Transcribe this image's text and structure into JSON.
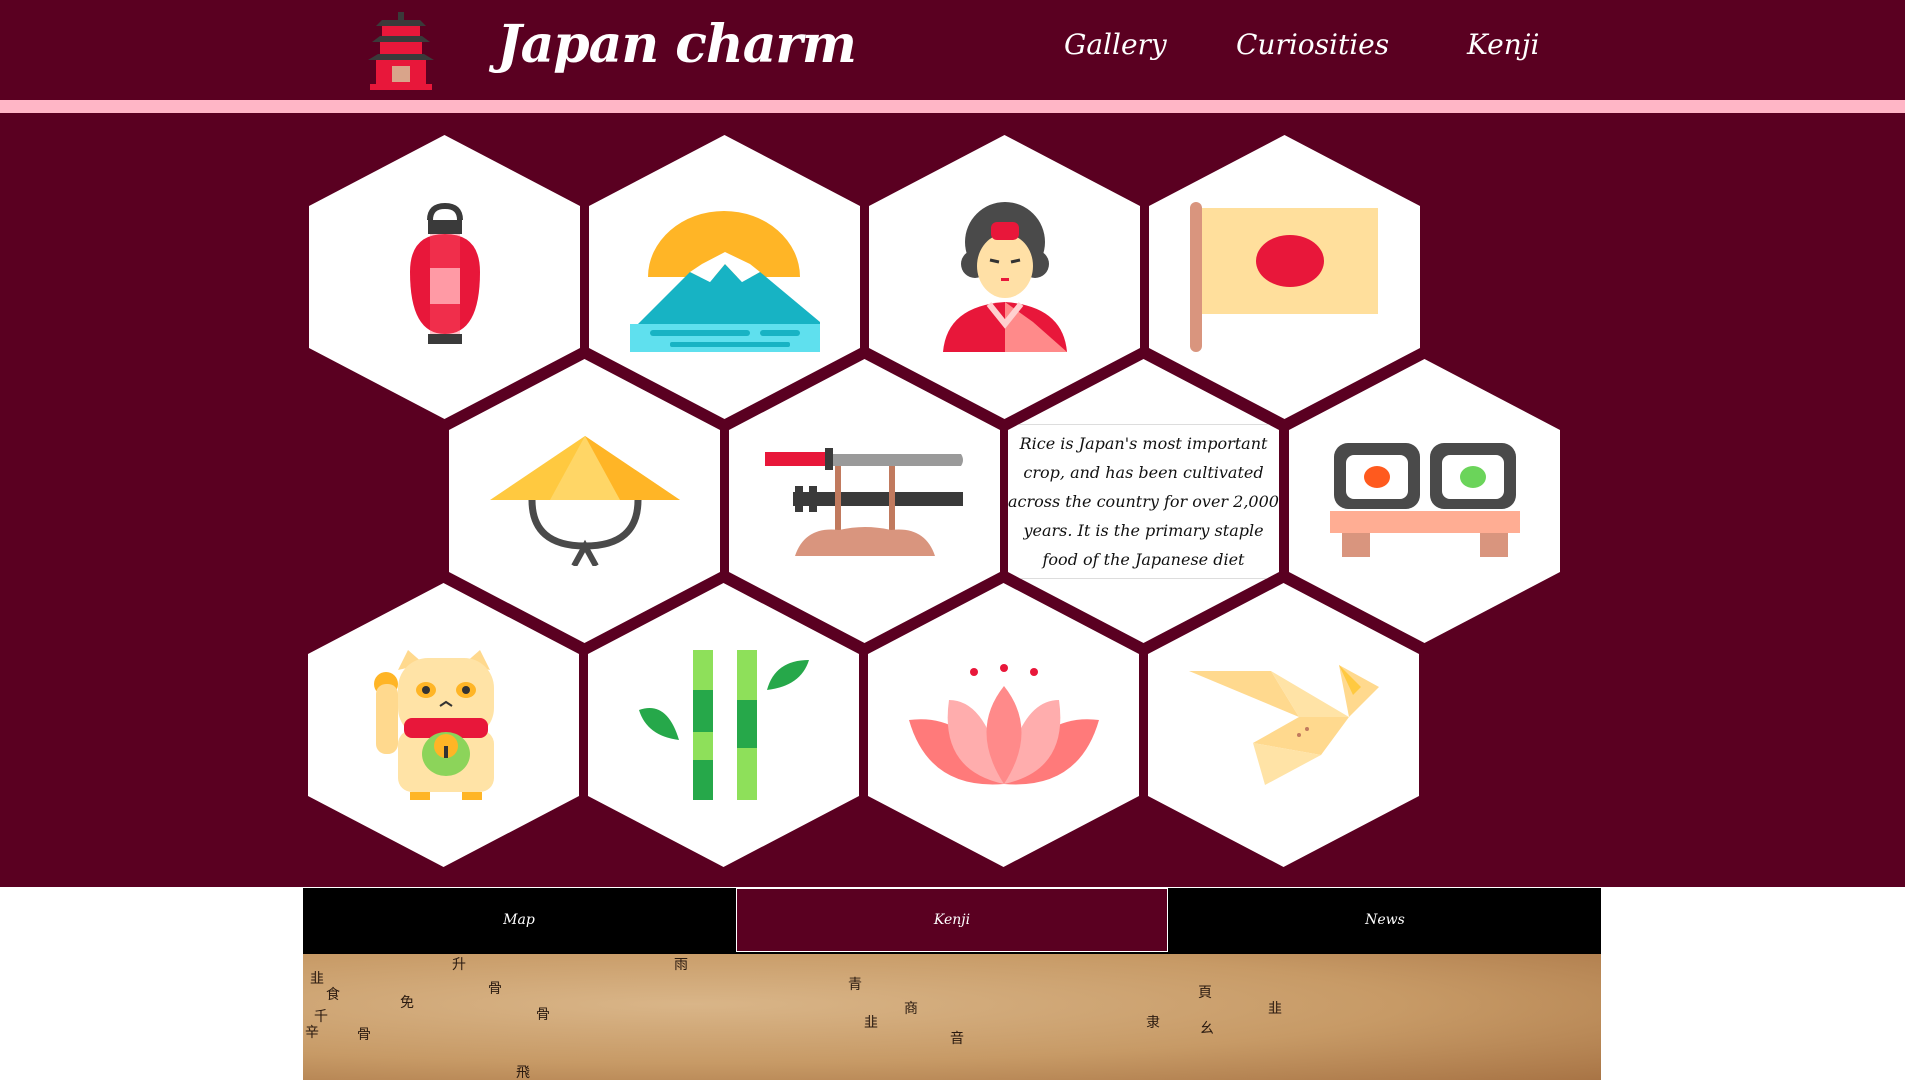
{
  "header": {
    "title": "Japan charm",
    "logo_icon": "pagoda-icon",
    "nav": [
      {
        "label": "Gallery"
      },
      {
        "label": "Curiosities"
      },
      {
        "label": "Kenji"
      }
    ]
  },
  "colors": {
    "primary": "#5a0021",
    "accent_bar": "#ffb6c6",
    "tab_bar": "#000000"
  },
  "gallery": {
    "tiles": [
      {
        "icon": "paper-lantern-icon"
      },
      {
        "icon": "mount-fuji-icon"
      },
      {
        "icon": "geisha-icon"
      },
      {
        "icon": "japan-flag-icon"
      },
      {
        "icon": "straw-hat-icon"
      },
      {
        "icon": "katana-stand-icon"
      },
      {
        "icon": "text-tile",
        "text": "Rice is Japan's most important crop, and has been cultivated across the country for over 2,000 years. It is the primary staple food of the Japanese diet"
      },
      {
        "icon": "sushi-icon"
      },
      {
        "icon": "lucky-cat-icon"
      },
      {
        "icon": "bamboo-icon"
      },
      {
        "icon": "lotus-icon"
      },
      {
        "icon": "origami-crane-icon"
      }
    ]
  },
  "tabs": [
    {
      "label": "Map",
      "active": false
    },
    {
      "label": "Kenji",
      "active": true
    },
    {
      "label": "News",
      "active": false
    }
  ],
  "map": {
    "kanji": [
      "韭",
      "食",
      "千",
      "辛",
      "骨",
      "免",
      "升",
      "骨",
      "骨",
      "雨",
      "飛",
      "青",
      "韭",
      "商",
      "音",
      "隶",
      "頁",
      "幺",
      "韭"
    ]
  }
}
